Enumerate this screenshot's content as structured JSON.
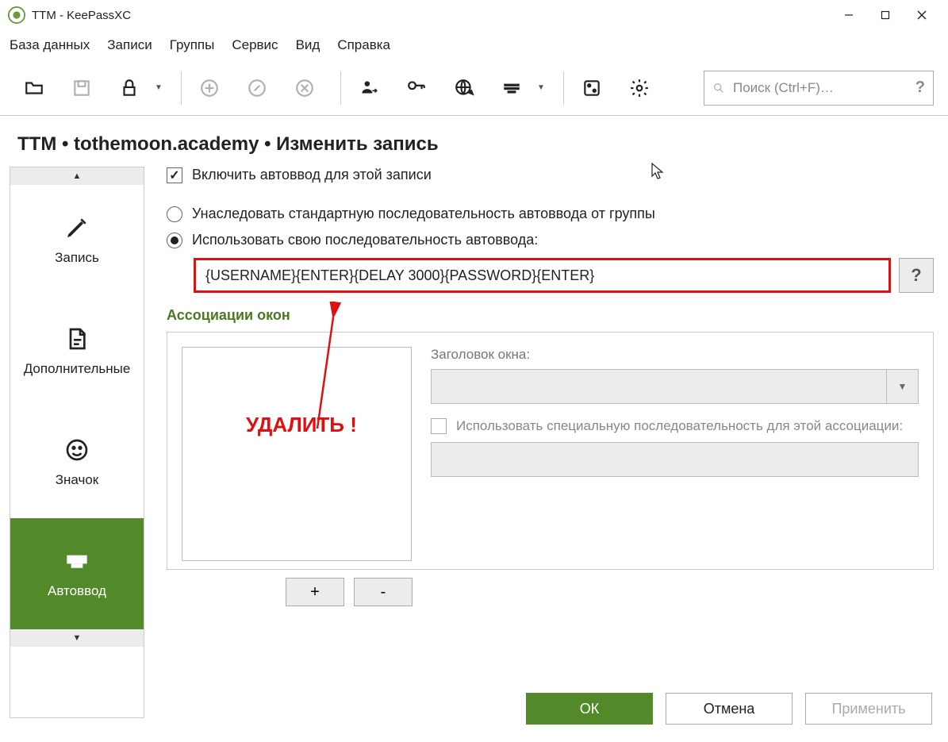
{
  "window": {
    "title": "TTM - KeePassXC"
  },
  "menu": [
    "База данных",
    "Записи",
    "Группы",
    "Сервис",
    "Вид",
    "Справка"
  ],
  "search": {
    "placeholder": "Поиск (Ctrl+F)…",
    "help": "?"
  },
  "heading": "TTM • tothemoon.academy • Изменить запись",
  "sidebar": {
    "tabs": [
      {
        "label": "Запись"
      },
      {
        "label": "Дополнительные"
      },
      {
        "label": "Значок"
      },
      {
        "label": "Автоввод"
      }
    ]
  },
  "form": {
    "enable_label": "Включить автоввод для этой записи",
    "inherit_label": "Унаследовать стандартную последовательность автоввода от группы",
    "custom_label": "Использовать свою последовательность автоввода:",
    "sequence": "{USERNAME}{ENTER}{DELAY 3000}{PASSWORD}{ENTER}",
    "help": "?",
    "assoc_header": "Ассоциации окон",
    "win_title_label": "Заголовок окна:",
    "use_special_label": "Использовать специальную последовательность для этой ассоциации:",
    "add": "+",
    "remove": "-"
  },
  "annotation": "УДАЛИТЬ !",
  "buttons": {
    "ok": "ОК",
    "cancel": "Отмена",
    "apply": "Применить"
  }
}
